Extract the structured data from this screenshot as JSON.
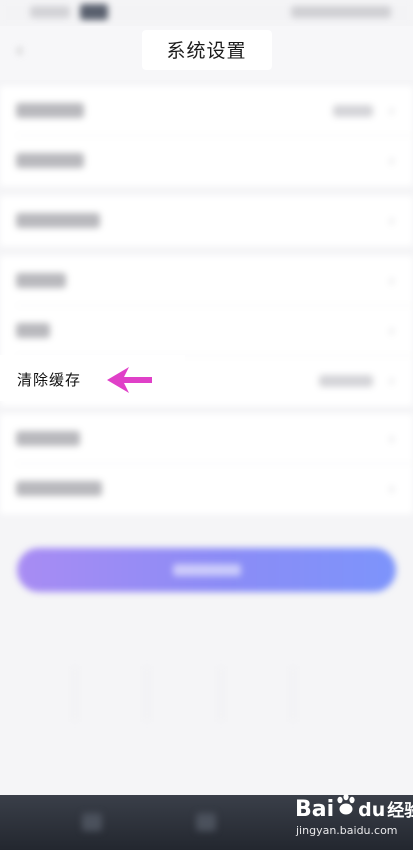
{
  "header": {
    "title": "系统设置"
  },
  "settings": {
    "clear_cache_label": "清除缓存"
  },
  "watermark": {
    "brand_left": "Bai",
    "brand_mid": "du",
    "brand_right": "经验",
    "url": "jingyan.baidu.com"
  },
  "colors": {
    "arrow": "#e040c8",
    "button_start": "#a88cf3",
    "button_end": "#7d94fb",
    "bottom_bar": "#2b2f37"
  },
  "icons": {
    "back": "chevron-left-icon",
    "row_arrow": "chevron-right-icon",
    "pointer": "arrow-left-icon"
  }
}
